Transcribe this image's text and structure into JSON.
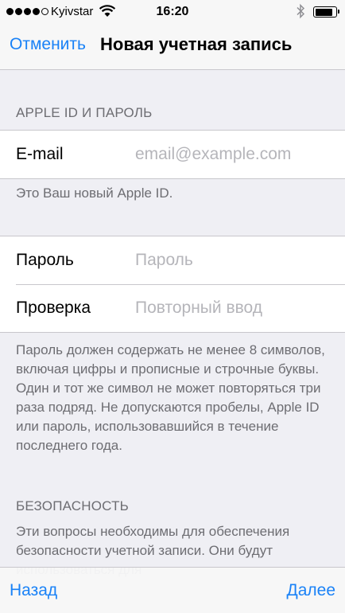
{
  "status_bar": {
    "signal_dots": 4,
    "carrier": "Kyivstar",
    "wifi_icon": "wifi-icon",
    "time": "16:20",
    "bluetooth_icon": "bluetooth-icon",
    "battery_level": 0.9
  },
  "nav": {
    "cancel_label": "Отменить",
    "title": "Новая учетная запись"
  },
  "apple_id_section": {
    "header": "APPLE ID И ПАРОЛЬ",
    "email_label": "E-mail",
    "email_placeholder": "email@example.com",
    "email_value": "",
    "footnote": "Это Ваш новый Apple ID."
  },
  "password_section": {
    "password_label": "Пароль",
    "password_placeholder": "Пароль",
    "verify_label": "Проверка",
    "verify_placeholder": "Повторный ввод",
    "footnote": "Пароль должен содержать не менее 8 символов, включая цифры и прописные и строчные буквы. Один и тот же символ не может повторяться три раза подряд. Не допускаются пробелы, Apple ID или пароль, использовавшийся в течение последнего года."
  },
  "security_section": {
    "header": "БЕЗОПАСНОСТЬ",
    "footnote": "Эти вопросы необходимы для обеспечения безопасности учетной записи. Они будут использоваться для"
  },
  "toolbar": {
    "back_label": "Назад",
    "next_label": "Далее"
  },
  "colors": {
    "accent": "#1a82f7",
    "background": "#efeff4",
    "secondary_text": "#6d6d72"
  }
}
